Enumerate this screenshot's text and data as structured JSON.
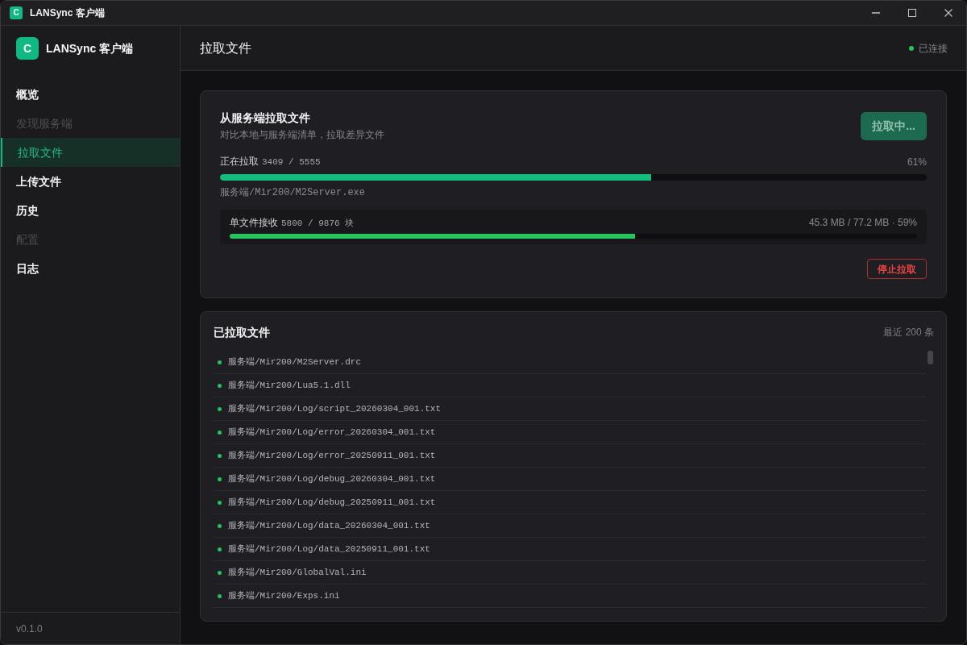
{
  "window": {
    "logo_letter": "C",
    "title": "LANSync 客户端"
  },
  "sidebar": {
    "logo_letter": "C",
    "brand": "LANSync 客户端",
    "items": [
      {
        "label": "概览",
        "selected": false,
        "disabled": false
      },
      {
        "label": "发现服务端",
        "selected": false,
        "disabled": true
      },
      {
        "label": "拉取文件",
        "selected": true,
        "disabled": false
      },
      {
        "label": "上传文件",
        "selected": false,
        "disabled": false
      },
      {
        "label": "历史",
        "selected": false,
        "disabled": false
      },
      {
        "label": "配置",
        "selected": false,
        "disabled": true
      },
      {
        "label": "日志",
        "selected": false,
        "disabled": false
      }
    ],
    "version": "v0.1.0"
  },
  "header": {
    "title": "拉取文件",
    "connected": true,
    "status": "已连接"
  },
  "pull_card": {
    "title": "从服务端拉取文件",
    "subtitle": "对比本地与服务端清单，拉取差异文件",
    "action_button": {
      "label": "拉取中...",
      "disabled": true
    },
    "overall": {
      "label": "正在拉取",
      "count": "3409 / 5555",
      "percent": "61%",
      "level": 0.61
    },
    "current_file": "服务端/Mir200/M2Server.exe",
    "file_progress": {
      "label": "单文件接收",
      "count": "5800 / 9876 块",
      "detail": "45.3 MB / 77.2 MB · 59%",
      "level": 0.59
    },
    "stop_button": "停止拉取"
  },
  "pulled_files": {
    "title": "已拉取文件",
    "count": "最近 200 条",
    "items": [
      "服务端/Mir200/M2Server.drc",
      "服务端/Mir200/Lua5.1.dll",
      "服务端/Mir200/Log/script_20260304_001.txt",
      "服务端/Mir200/Log/error_20260304_001.txt",
      "服务端/Mir200/Log/error_20250911_001.txt",
      "服务端/Mir200/Log/debug_20260304_001.txt",
      "服务端/Mir200/Log/debug_20250911_001.txt",
      "服务端/Mir200/Log/data_20260304_001.txt",
      "服务端/Mir200/Log/data_20250911_001.txt",
      "服务端/Mir200/GlobalVal.ini",
      "服务端/Mir200/Exps.ini"
    ]
  }
}
